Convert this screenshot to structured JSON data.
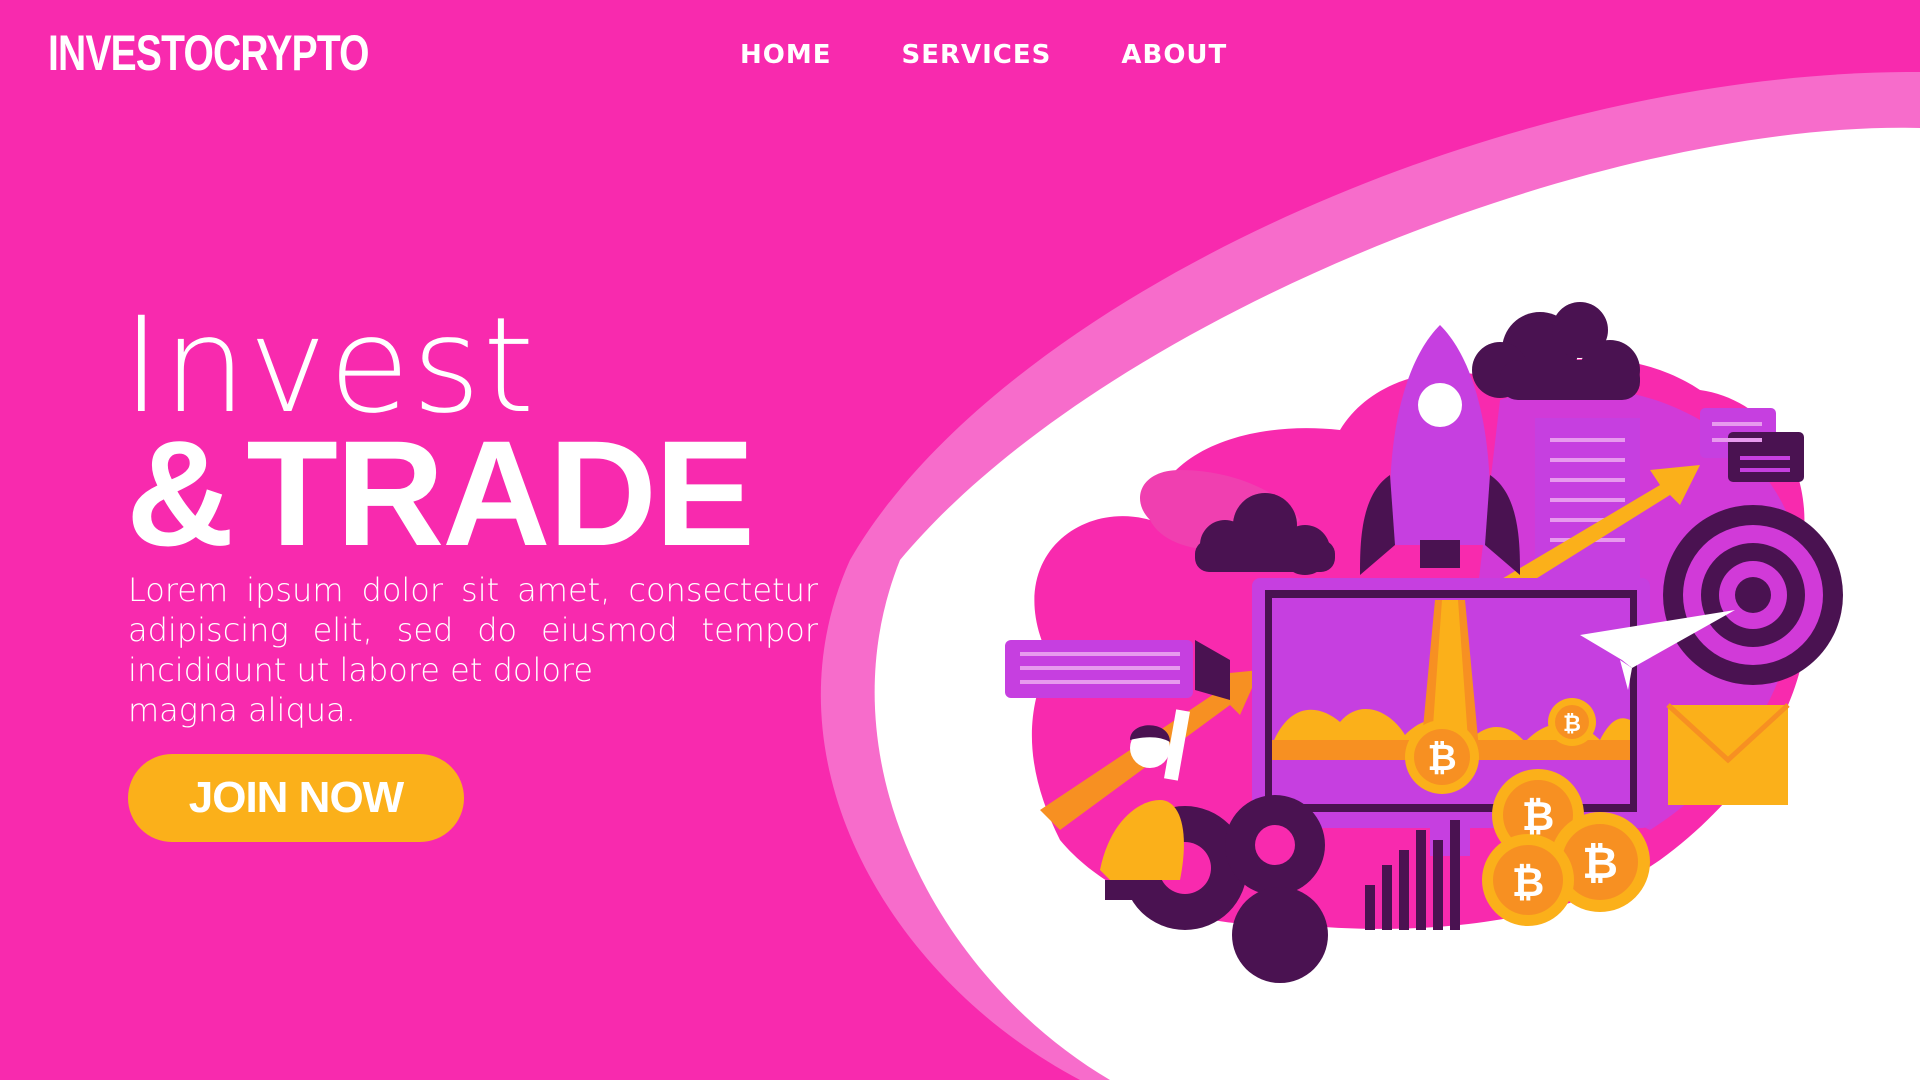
{
  "header": {
    "logo_text": "INVESTOCRYPTO",
    "nav": [
      {
        "label": "HOME"
      },
      {
        "label": "SERVICES"
      },
      {
        "label": "ABOUT"
      }
    ]
  },
  "hero": {
    "title_line1": "Invest",
    "title_amp": "&",
    "title_line2": "TRADE",
    "description_lines": [
      "Lorem ipsum dolor sit amet, consectetur",
      "adipiscing elit, sed do eiusmod tempor",
      "incididunt ut labore et dolore",
      "magna aliqua."
    ],
    "cta_label": "JOIN NOW"
  },
  "illustration": {
    "coin_symbol": "₿"
  },
  "colors": {
    "background": "#f82aae",
    "accent": "#fbb01a",
    "purple": "#c63fe0",
    "dark_purple": "#4a1251",
    "light_pink": "#f76ccb"
  }
}
